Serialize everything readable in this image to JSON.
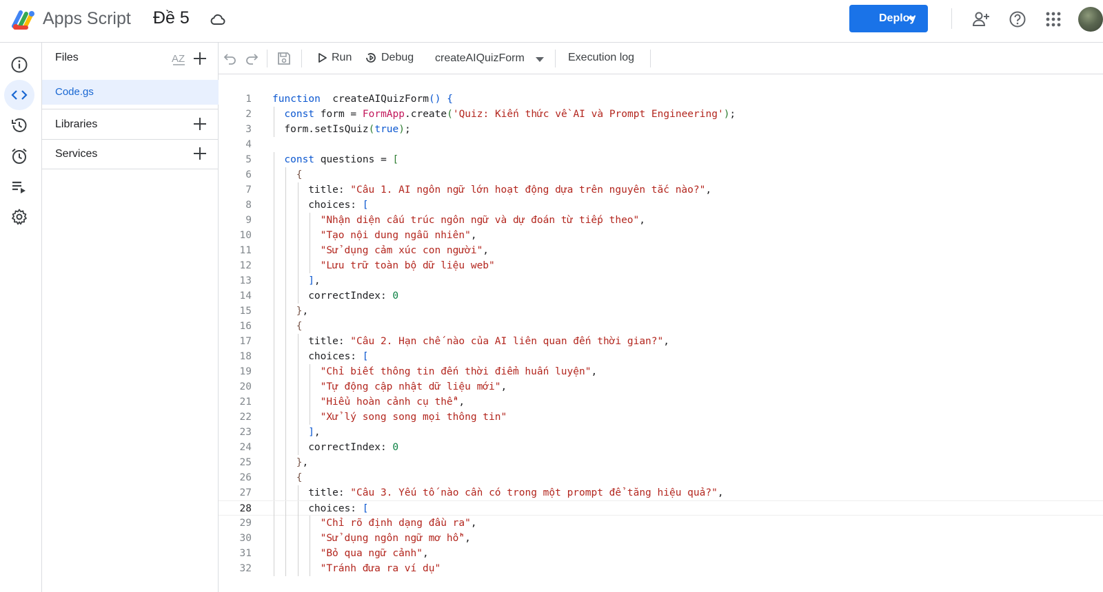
{
  "header": {
    "app_name": "Apps Script",
    "project_title": "Đề 5",
    "deploy_label": "Deploy"
  },
  "files_panel": {
    "title": "Files",
    "files": [
      "Code.gs"
    ],
    "libraries_label": "Libraries",
    "services_label": "Services"
  },
  "editor_toolbar": {
    "run_label": "Run",
    "debug_label": "Debug",
    "function_name": "createAIQuizForm",
    "execution_log_label": "Execution log"
  },
  "editor": {
    "current_line": 28,
    "lines": [
      {
        "n": "1",
        "ind": 0,
        "t": [
          [
            "kw",
            "function"
          ],
          [
            "",
            "  createAIQuizForm"
          ],
          [
            "br1",
            "()"
          ],
          [
            "",
            " "
          ],
          [
            "br1",
            "{"
          ]
        ]
      },
      {
        "n": "2",
        "ind": 1,
        "t": [
          [
            "kw",
            "const"
          ],
          [
            "",
            " form = "
          ],
          [
            "fnc",
            "FormApp"
          ],
          [
            "",
            ".create"
          ],
          [
            "br2",
            "("
          ],
          [
            "str",
            "'Quiz: Kiến thức về AI và Prompt Engineering'"
          ],
          [
            "br2",
            ")"
          ],
          [
            "",
            ";"
          ]
        ]
      },
      {
        "n": "3",
        "ind": 1,
        "t": [
          [
            "",
            "form.setIsQuiz"
          ],
          [
            "br2",
            "("
          ],
          [
            "kw",
            "true"
          ],
          [
            "br2",
            ")"
          ],
          [
            "",
            ";"
          ]
        ]
      },
      {
        "n": "4",
        "ind": 0,
        "t": []
      },
      {
        "n": "5",
        "ind": 1,
        "t": [
          [
            "kw",
            "const"
          ],
          [
            "",
            " questions = "
          ],
          [
            "br2",
            "["
          ]
        ]
      },
      {
        "n": "6",
        "ind": 2,
        "t": [
          [
            "br3",
            "{"
          ]
        ]
      },
      {
        "n": "7",
        "ind": 3,
        "t": [
          [
            "",
            "title: "
          ],
          [
            "str",
            "\"Câu 1. AI ngôn ngữ lớn hoạt động dựa trên nguyên tắc nào?\""
          ],
          [
            "",
            ","
          ]
        ]
      },
      {
        "n": "8",
        "ind": 3,
        "t": [
          [
            "",
            "choices: "
          ],
          [
            "br1",
            "["
          ]
        ]
      },
      {
        "n": "9",
        "ind": 4,
        "t": [
          [
            "str",
            "\"Nhận diện cấu trúc ngôn ngữ và dự đoán từ tiếp theo\""
          ],
          [
            "",
            ","
          ]
        ]
      },
      {
        "n": "10",
        "ind": 4,
        "t": [
          [
            "str",
            "\"Tạo nội dung ngẫu nhiên\""
          ],
          [
            "",
            ","
          ]
        ]
      },
      {
        "n": "11",
        "ind": 4,
        "t": [
          [
            "str",
            "\"Sử dụng cảm xúc con người\""
          ],
          [
            "",
            ","
          ]
        ]
      },
      {
        "n": "12",
        "ind": 4,
        "t": [
          [
            "str",
            "\"Lưu trữ toàn bộ dữ liệu web\""
          ]
        ]
      },
      {
        "n": "13",
        "ind": 3,
        "t": [
          [
            "br1",
            "]"
          ],
          [
            "",
            ","
          ]
        ]
      },
      {
        "n": "14",
        "ind": 3,
        "t": [
          [
            "",
            "correctIndex: "
          ],
          [
            "num",
            "0"
          ]
        ]
      },
      {
        "n": "15",
        "ind": 2,
        "t": [
          [
            "br3",
            "}"
          ],
          [
            "",
            ","
          ]
        ]
      },
      {
        "n": "16",
        "ind": 2,
        "t": [
          [
            "br3",
            "{"
          ]
        ]
      },
      {
        "n": "17",
        "ind": 3,
        "t": [
          [
            "",
            "title: "
          ],
          [
            "str",
            "\"Câu 2. Hạn chế nào của AI liên quan đến thời gian?\""
          ],
          [
            "",
            ","
          ]
        ]
      },
      {
        "n": "18",
        "ind": 3,
        "t": [
          [
            "",
            "choices: "
          ],
          [
            "br1",
            "["
          ]
        ]
      },
      {
        "n": "19",
        "ind": 4,
        "t": [
          [
            "str",
            "\"Chỉ biết thông tin đến thời điểm huấn luyện\""
          ],
          [
            "",
            ","
          ]
        ]
      },
      {
        "n": "20",
        "ind": 4,
        "t": [
          [
            "str",
            "\"Tự động cập nhật dữ liệu mới\""
          ],
          [
            "",
            ","
          ]
        ]
      },
      {
        "n": "21",
        "ind": 4,
        "t": [
          [
            "str",
            "\"Hiểu hoàn cảnh cụ thể\""
          ],
          [
            "",
            ","
          ]
        ]
      },
      {
        "n": "22",
        "ind": 4,
        "t": [
          [
            "str",
            "\"Xử lý song song mọi thông tin\""
          ]
        ]
      },
      {
        "n": "23",
        "ind": 3,
        "t": [
          [
            "br1",
            "]"
          ],
          [
            "",
            ","
          ]
        ]
      },
      {
        "n": "24",
        "ind": 3,
        "t": [
          [
            "",
            "correctIndex: "
          ],
          [
            "num",
            "0"
          ]
        ]
      },
      {
        "n": "25",
        "ind": 2,
        "t": [
          [
            "br3",
            "}"
          ],
          [
            "",
            ","
          ]
        ]
      },
      {
        "n": "26",
        "ind": 2,
        "t": [
          [
            "br3",
            "{"
          ]
        ]
      },
      {
        "n": "27",
        "ind": 3,
        "t": [
          [
            "",
            "title: "
          ],
          [
            "str",
            "\"Câu 3. Yếu tố nào cần có trong một prompt để tăng hiệu quả?\""
          ],
          [
            "",
            ","
          ]
        ]
      },
      {
        "n": "28",
        "ind": 3,
        "t": [
          [
            "",
            "choices: "
          ],
          [
            "br1",
            "["
          ]
        ]
      },
      {
        "n": "29",
        "ind": 4,
        "t": [
          [
            "str",
            "\"Chỉ rõ định dạng đầu ra\""
          ],
          [
            "",
            ","
          ]
        ]
      },
      {
        "n": "30",
        "ind": 4,
        "t": [
          [
            "str",
            "\"Sử dụng ngôn ngữ mơ hồ\""
          ],
          [
            "",
            ","
          ]
        ]
      },
      {
        "n": "31",
        "ind": 4,
        "t": [
          [
            "str",
            "\"Bỏ qua ngữ cảnh\""
          ],
          [
            "",
            ","
          ]
        ]
      },
      {
        "n": "32",
        "ind": 4,
        "t": [
          [
            "str",
            "\"Tránh đưa ra ví dụ\""
          ]
        ]
      }
    ]
  }
}
